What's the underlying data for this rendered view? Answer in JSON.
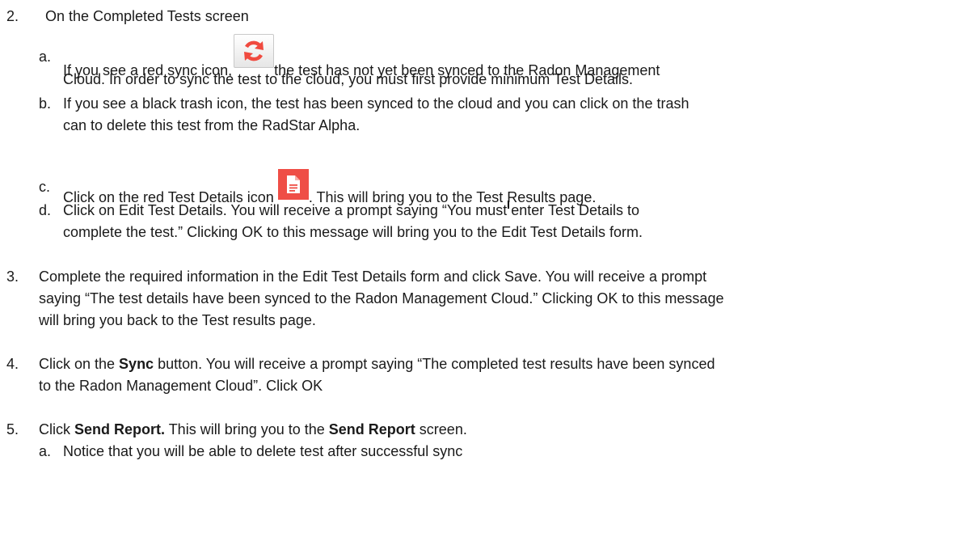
{
  "step2": {
    "num": "2.",
    "title": "On the Completed Tests screen",
    "a": {
      "letter": "a.",
      "pre": "If you see a red sync icon,",
      "post": "the test has not yet been synced to the Radon Management",
      "cont": "Cloud.  In order to sync the test to the cloud, you must first provide minimum Test Details."
    },
    "b": {
      "letter": "b.",
      "l1": "If you see a black trash icon, the test has been synced to the cloud and you can click on the trash",
      "l2": "can to delete this test from the RadStar Alpha."
    },
    "c": {
      "letter": "c.",
      "pre": "Click on the red Test Details icon",
      "post": ".  This will bring you to the Test Results page."
    },
    "d": {
      "letter": "d.",
      "l1": "Click on Edit Test Details.  You will receive a prompt saying “You must enter Test Details to",
      "l2": "complete the test.”  Clicking OK to this message will bring you to the Edit Test Details form."
    }
  },
  "step3": {
    "num": "3.",
    "l1": "Complete the required information in the Edit Test Details form and click Save.  You will receive a prompt",
    "l2": "saying “The test details have been synced to the Radon Management Cloud.”  Clicking OK to this message",
    "l3": "will bring you back to the Test results page."
  },
  "step4": {
    "num": "4.",
    "pre": "Click on the ",
    "bold": "Sync",
    "post": " button.  You will receive a prompt saying “The completed test results have been synced",
    "l2": "to the Radon Management Cloud”.  Click OK"
  },
  "step5": {
    "num": "5.",
    "pre": "Click ",
    "bold1": "Send Report.",
    "mid": "  This will bring you to the ",
    "bold2": "Send Report",
    "post": " screen.",
    "a": {
      "letter": "a.",
      "text": "Notice that you will be able to delete test after successful sync"
    }
  },
  "icons": {
    "sync": "sync-icon",
    "document": "document-icon",
    "sync_color": "#f04a3f",
    "doc_color": "#ef4e46"
  }
}
